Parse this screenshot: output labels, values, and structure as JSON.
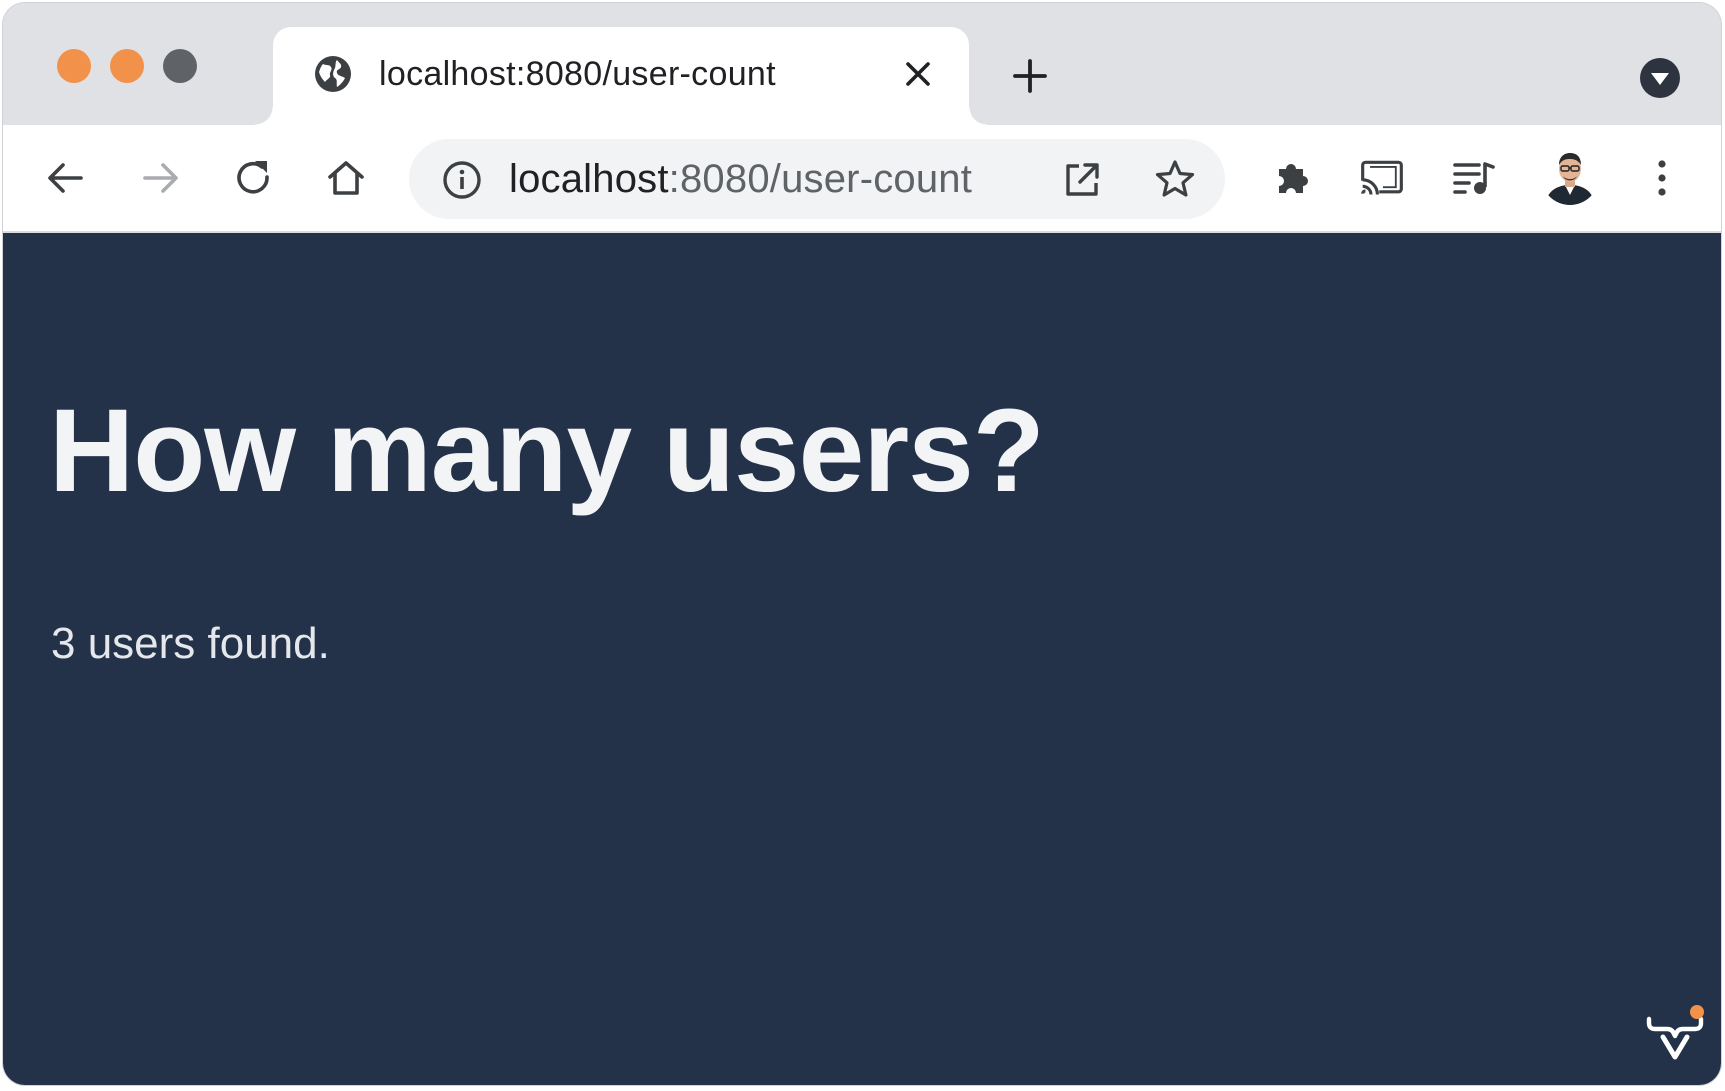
{
  "window": {
    "traffic_colors": [
      "#f2914a",
      "#f2914a",
      "#5f6368"
    ]
  },
  "tab": {
    "title": "localhost:8080/user-count",
    "favicon": "globe-icon",
    "close_icon": "close-icon"
  },
  "toolbar": {
    "back_icon": "arrow-left-icon",
    "forward_icon": "arrow-right-icon",
    "reload_icon": "reload-icon",
    "home_icon": "home-icon",
    "site_info_icon": "info-icon",
    "address_host": "localhost",
    "address_rest": ":8080/user-count",
    "open_in_app_icon": "open-external-icon",
    "bookmark_icon": "star-icon",
    "extensions_icon": "puzzle-icon",
    "cast_icon": "cast-icon",
    "media_icon": "media-queue-icon",
    "profile_icon": "avatar",
    "menu_icon": "kebab-menu-icon"
  },
  "page": {
    "title": "How many users?",
    "message": "3 users found.",
    "background": "#233249",
    "logo": "vaadin-logo"
  }
}
